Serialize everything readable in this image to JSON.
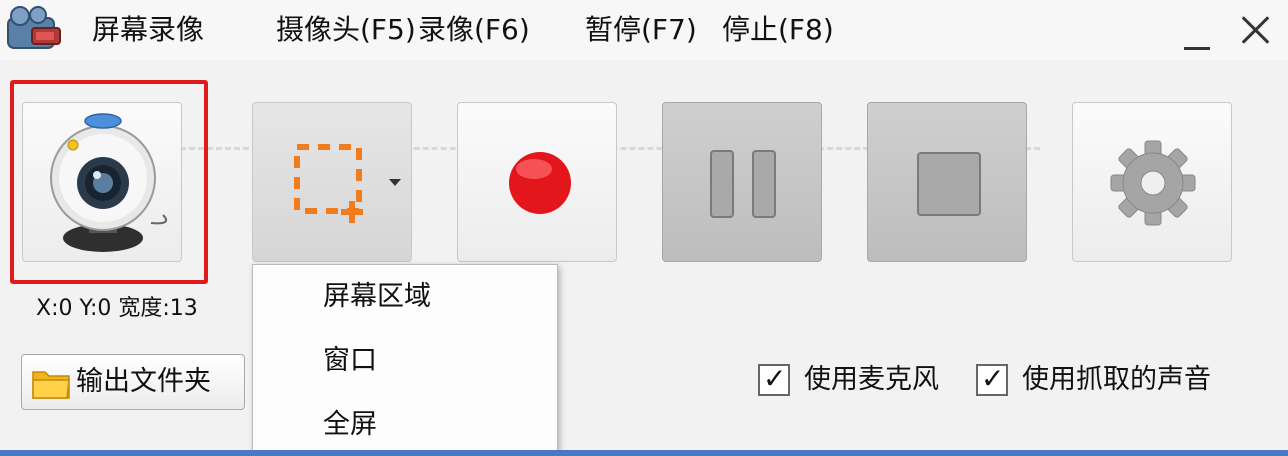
{
  "window": {
    "title": "屏幕录像",
    "menu": [
      {
        "label": "摄像头(F5)"
      },
      {
        "label": "录像(F6)"
      },
      {
        "label": "暂停(F7)"
      },
      {
        "label": "停止(F8)"
      }
    ]
  },
  "toolbar": {
    "buttons": [
      {
        "icon": "webcam-icon"
      },
      {
        "icon": "region-select-icon"
      },
      {
        "icon": "record-icon"
      },
      {
        "icon": "pause-icon"
      },
      {
        "icon": "stop-icon"
      },
      {
        "icon": "gear-icon"
      }
    ],
    "highlight_color": "#e11a1a"
  },
  "status": {
    "coords": "X:0 Y:0 宽度:13"
  },
  "output_folder": {
    "label": "输出文件夹",
    "icon": "folder-icon"
  },
  "capture_menu": {
    "items": [
      "屏幕区域",
      "窗口",
      "全屏"
    ]
  },
  "options": {
    "use_mic": {
      "label": "使用麦克风",
      "checked": true
    },
    "use_capture_audio": {
      "label": "使用抓取的声音",
      "checked": true
    }
  },
  "colors": {
    "record": "#e2161b",
    "region": "#f07c1e",
    "accent": "#4a78c4"
  }
}
